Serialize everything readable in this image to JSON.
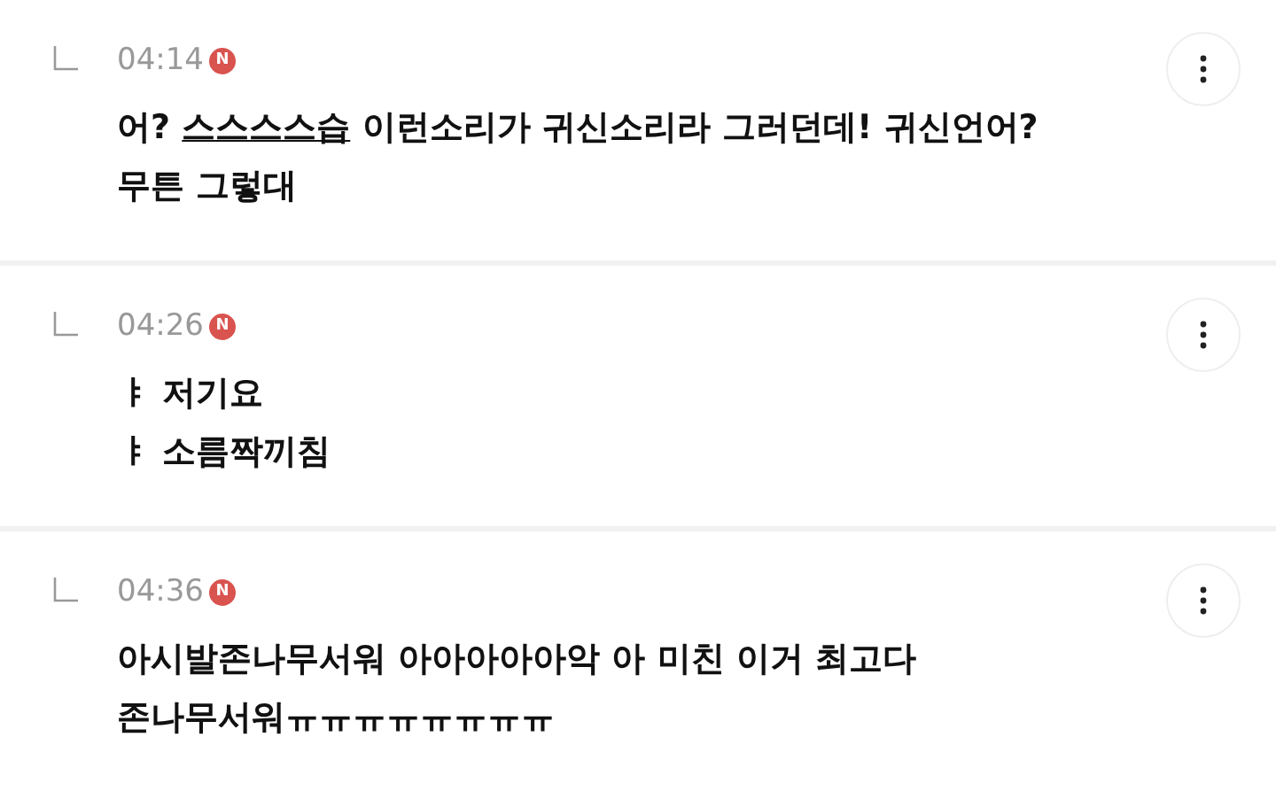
{
  "comments": [
    {
      "time": "04:14",
      "badge": "N",
      "lines": [
        [
          {
            "text": "어? "
          },
          {
            "text": "스스스스습",
            "kind": "link"
          },
          {
            "text": " 이런소리가 귀신소리라 그러던데! 귀신언어?"
          }
        ],
        [
          {
            "text": "무튼 그렇대"
          }
        ]
      ]
    },
    {
      "time": "04:26",
      "badge": "N",
      "lines": [
        [
          {
            "text": "ㅑ 저기요"
          }
        ],
        [
          {
            "text": "ㅑ 소름짝끼침"
          }
        ]
      ]
    },
    {
      "time": "04:36",
      "badge": "N",
      "lines": [
        [
          {
            "text": "아시발존나무서워 아아아아아악 아 미친 이거 최고다"
          }
        ],
        [
          {
            "text": "존나무서워ㅠㅠㅠㅠㅠㅠㅠㅠ"
          }
        ]
      ]
    }
  ]
}
